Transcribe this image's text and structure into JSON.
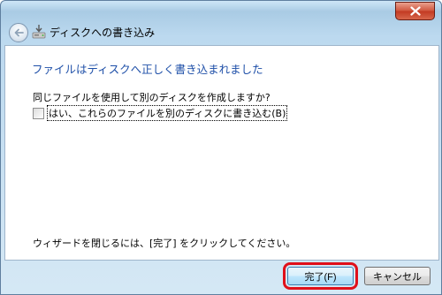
{
  "window": {
    "title": "ディスクへの書き込み",
    "close_icon": "close-icon",
    "back_icon": "back-arrow-icon",
    "disk_icon": "disk-burn-icon"
  },
  "content": {
    "heading": "ファイルはディスクへ正しく書き込まれました",
    "question": "同じファイルを使用して別のディスクを作成しますか?",
    "checkbox_label": "はい、これらのファイルを別のディスクに書き込む(B)",
    "checkbox_checked": false,
    "finish_instruction": "ウィザードを閉じるには、[完了] をクリックしてください。"
  },
  "buttons": {
    "finish": "完了(F)",
    "cancel": "キャンセル"
  },
  "colors": {
    "heading": "#1e4fa8",
    "highlight_outline": "#e0101a"
  }
}
